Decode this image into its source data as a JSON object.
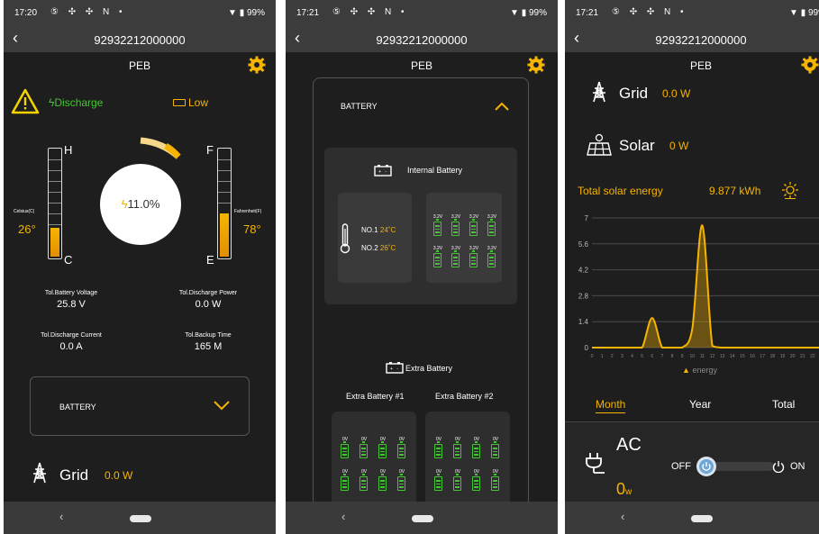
{
  "screens": [
    {
      "status": {
        "time": "17:20",
        "battery": "99%"
      },
      "toolbar": {
        "title": "92932212000000"
      },
      "page_title": "PEB",
      "discharge": "Discharge",
      "level": "Low",
      "temp": {
        "c_label": "Celsius(C)",
        "c_value": "26",
        "c_unit": "°",
        "f_label": "Fahrenheit(F)",
        "f_value": "78",
        "f_unit": "°",
        "h": "H",
        "c": "C",
        "f": "F",
        "e": "E"
      },
      "soc": "11.0%",
      "stats": [
        {
          "label": "Tol.Battery Voltage",
          "value": "25.8 V"
        },
        {
          "label": "Tol.Discharge Power",
          "value": "0.0 W"
        },
        {
          "label": "Tol.Discharge Current",
          "value": "0.0 A"
        },
        {
          "label": "Tol.Backup Time",
          "value": "165 M"
        }
      ],
      "battery_section": "BATTERY",
      "grid": {
        "label": "Grid",
        "value": "0.0 W"
      }
    },
    {
      "status": {
        "time": "17:21",
        "battery": "99%"
      },
      "toolbar": {
        "title": "92932212000000"
      },
      "page_title": "PEB",
      "battery_section": "BATTERY",
      "internal": {
        "title": "Internal Battery",
        "no1_label": "NO.1",
        "no1_temp": "24˚C",
        "no2_label": "NO.2",
        "no2_temp": "26˚C",
        "cell_voltage": "3.2V"
      },
      "extra": {
        "title": "Extra Battery",
        "b1": "Extra Battery #1",
        "b2": "Extra Battery #2",
        "cell_voltage": "0V"
      }
    },
    {
      "status": {
        "time": "17:21",
        "battery": "99%"
      },
      "toolbar": {
        "title": "92932212000000"
      },
      "page_title": "PEB",
      "grid": {
        "label": "Grid",
        "value": "0.0 W"
      },
      "solar": {
        "label": "Solar",
        "value": "0 W"
      },
      "total_solar": {
        "label": "Total solar energy",
        "value": "9.877 kWh"
      },
      "legend": "energy",
      "tabs": [
        "Month",
        "Year",
        "Total"
      ],
      "ac": {
        "label": "AC",
        "value": "0",
        "unit": "w",
        "off": "OFF",
        "on": "ON"
      }
    }
  ],
  "chart_data": {
    "type": "area",
    "x": [
      0,
      1,
      2,
      3,
      4,
      5,
      6,
      7,
      8,
      9,
      10,
      11,
      12,
      13,
      14,
      15,
      16,
      17,
      18,
      19,
      20,
      21,
      22,
      23
    ],
    "y_ticks": [
      "7",
      "5.6",
      "4.2",
      "2.8",
      "1.4",
      "0"
    ],
    "ylim": [
      0,
      7
    ],
    "series": [
      {
        "name": "energy",
        "values": [
          0,
          0,
          0,
          0,
          0,
          0,
          1.6,
          0,
          0,
          0,
          1.0,
          6.6,
          0.1,
          0,
          0,
          0,
          0,
          0,
          0,
          0,
          0,
          0,
          0,
          0
        ]
      }
    ],
    "grid": true,
    "legend": "bottom-center",
    "color": "#f5b400"
  }
}
